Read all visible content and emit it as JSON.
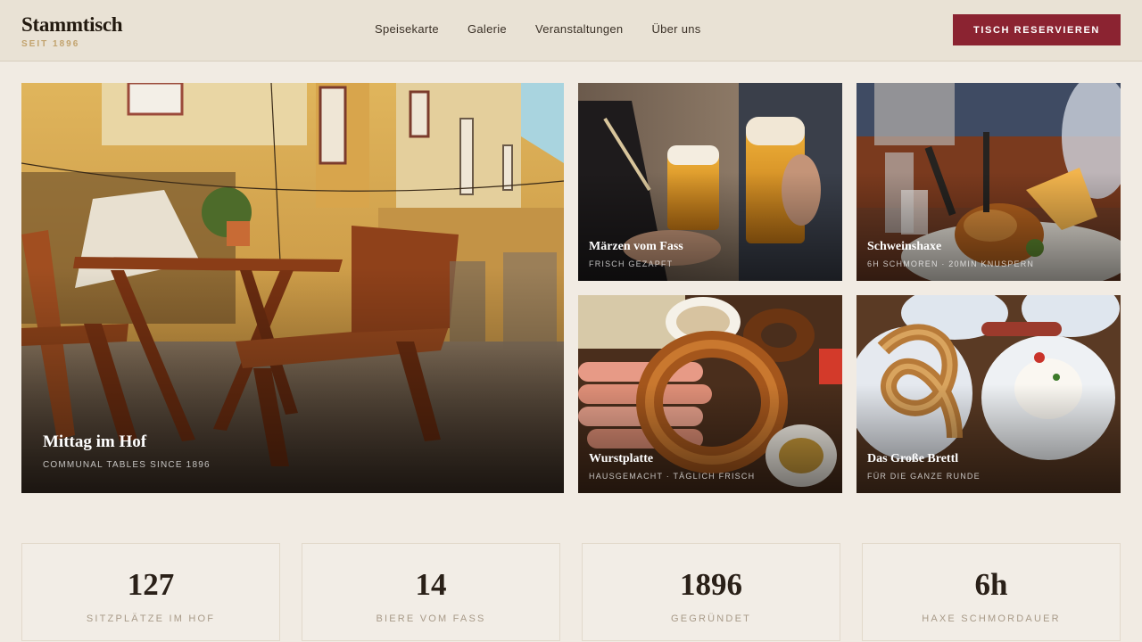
{
  "brand": {
    "name": "Stammtisch",
    "tagline": "SEIT 1896"
  },
  "nav": [
    {
      "label": "Speisekarte"
    },
    {
      "label": "Galerie"
    },
    {
      "label": "Veranstaltungen"
    },
    {
      "label": "Über uns"
    }
  ],
  "cta": {
    "label": "TISCH RESERVIEREN"
  },
  "gallery": [
    {
      "title": "Mittag im Hof",
      "subtitle": "COMMUNAL TABLES SINCE 1896"
    },
    {
      "title": "Märzen vom Fass",
      "subtitle": "FRISCH GEZAPFT"
    },
    {
      "title": "Schweinshaxe",
      "subtitle": "6H SCHMOREN · 20MIN KNUSPERN"
    },
    {
      "title": "Wurstplatte",
      "subtitle": "HAUSGEMACHT · TÄGLICH FRISCH"
    },
    {
      "title": "Das Große Brettl",
      "subtitle": "FÜR DIE GANZE RUNDE"
    }
  ],
  "stats": [
    {
      "value": "127",
      "label": "SITZPLÄTZE IM HOF"
    },
    {
      "value": "14",
      "label": "BIERE VOM FASS"
    },
    {
      "value": "1896",
      "label": "GEGRÜNDET"
    },
    {
      "value": "6h",
      "label": "HAXE SCHMORDAUER"
    }
  ],
  "colors": {
    "accent": "#8b2331",
    "gold": "#c2a36e",
    "background": "#f1ebe3",
    "header": "#e9e2d5"
  }
}
